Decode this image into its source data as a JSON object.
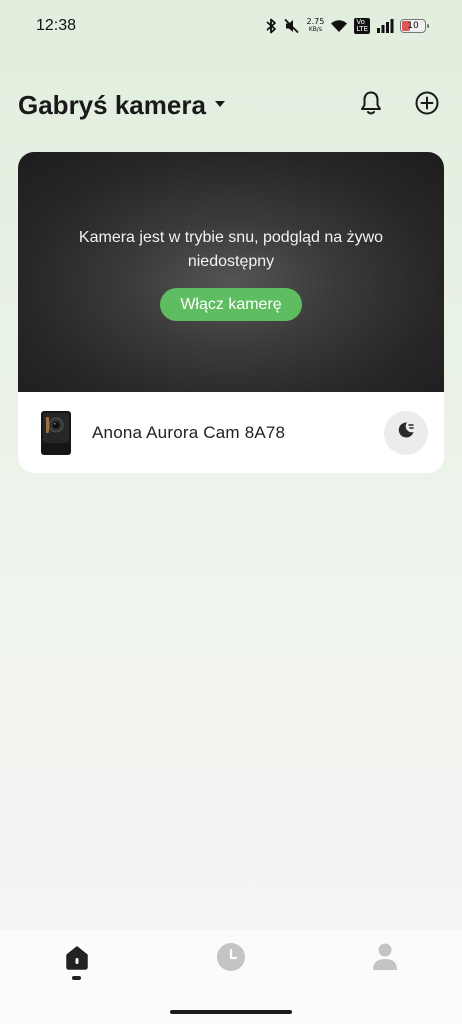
{
  "status_bar": {
    "time": "12:38",
    "net_speed_value": "2.75",
    "net_speed_unit": "KB/s",
    "volte_line1": "Vo",
    "volte_line2": "LTE",
    "battery_level": "10",
    "icons": [
      "bluetooth-icon",
      "mute-icon",
      "wifi-icon",
      "signal-icon",
      "battery-icon"
    ]
  },
  "header": {
    "title": "Gabryś kamera",
    "icons": [
      "caret-down-icon",
      "bell-icon",
      "add-circle-icon"
    ]
  },
  "camera_card": {
    "sleep_message": "Kamera jest w trybie snu, podgląd na żywo niedostępny",
    "wake_button_label": "Włącz kamerę",
    "device_name": "Anona Aurora Cam 8A78",
    "sleep_icon": "moon-icon"
  },
  "bottom_nav": {
    "items": [
      "home",
      "history",
      "profile"
    ],
    "active": "home"
  },
  "colors": {
    "accent_green": "#5ebd60",
    "preview_dark": "#262626",
    "nav_inactive": "#c4c4c4",
    "battery_low": "#e05555"
  }
}
